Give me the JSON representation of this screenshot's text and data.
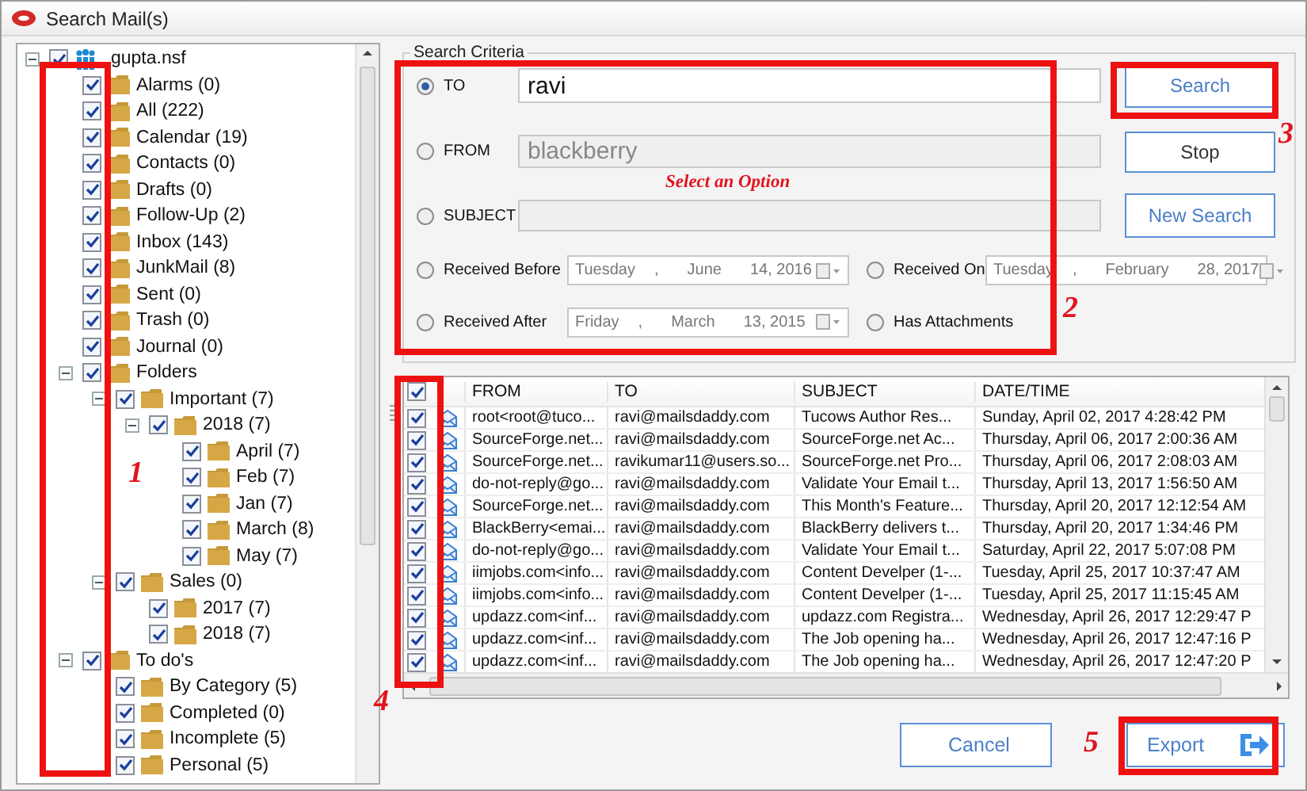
{
  "window": {
    "title": "Search Mail(s)"
  },
  "tree": {
    "label": "gupta.nsf",
    "checked": true,
    "expanded": true,
    "children": [
      {
        "label": "Alarms (0)",
        "checked": true
      },
      {
        "label": "All (222)",
        "checked": true
      },
      {
        "label": "Calendar (19)",
        "checked": true
      },
      {
        "label": "Contacts (0)",
        "checked": true
      },
      {
        "label": "Drafts (0)",
        "checked": true
      },
      {
        "label": "Follow-Up (2)",
        "checked": true
      },
      {
        "label": "Inbox (143)",
        "checked": true
      },
      {
        "label": "JunkMail (8)",
        "checked": true
      },
      {
        "label": "Sent (0)",
        "checked": true
      },
      {
        "label": "Trash (0)",
        "checked": true
      },
      {
        "label": "Journal (0)",
        "checked": true
      },
      {
        "label": "Folders",
        "checked": true,
        "expanded": true,
        "children": [
          {
            "label": "Important (7)",
            "checked": true,
            "expanded": true,
            "children": [
              {
                "label": "2018 (7)",
                "checked": true,
                "expanded": true,
                "children": [
                  {
                    "label": "April (7)",
                    "checked": true
                  },
                  {
                    "label": "Feb (7)",
                    "checked": true
                  },
                  {
                    "label": "Jan (7)",
                    "checked": true
                  },
                  {
                    "label": "March (8)",
                    "checked": true
                  },
                  {
                    "label": "May (7)",
                    "checked": true
                  }
                ]
              }
            ]
          },
          {
            "label": "Sales (0)",
            "checked": true,
            "expanded": true,
            "children": [
              {
                "label": "2017 (7)",
                "checked": true
              },
              {
                "label": "2018 (7)",
                "checked": true
              }
            ]
          }
        ]
      },
      {
        "label": "To do's",
        "checked": true,
        "expanded": true,
        "children": [
          {
            "label": "By Category (5)",
            "checked": true
          },
          {
            "label": "Completed (0)",
            "checked": true
          },
          {
            "label": "Incomplete (5)",
            "checked": true
          },
          {
            "label": "Personal (5)",
            "checked": true
          }
        ]
      }
    ]
  },
  "criteria": {
    "title": "Search Criteria",
    "fields": [
      {
        "label": "TO",
        "selected": true,
        "value": "ravi",
        "disabled": false
      },
      {
        "label": "FROM",
        "selected": false,
        "value": "blackberry",
        "disabled": true
      },
      {
        "label": "SUBJECT",
        "selected": false,
        "disabled": true
      }
    ],
    "hint": "Select an Option",
    "dates": [
      {
        "label": "Received Before",
        "selected": false,
        "parts": [
          "Tuesday",
          ",",
          "June",
          "14, 2016"
        ]
      },
      {
        "label": "Received On",
        "selected": false,
        "parts": [
          "Tuesday",
          ",",
          "February",
          "28, 2017"
        ]
      },
      {
        "label": "Received After",
        "selected": false,
        "parts": [
          "Friday",
          ",",
          "March",
          "13, 2015"
        ]
      }
    ],
    "attachments": {
      "label": "Has Attachments",
      "selected": false
    }
  },
  "actions": [
    {
      "label": "Search"
    },
    {
      "label": "Stop"
    },
    {
      "label": "New Search"
    }
  ],
  "table": {
    "all_checked": true,
    "columns": [
      "FROM",
      "TO",
      "SUBJECT",
      "DATE/TIME"
    ],
    "rows": [
      {
        "checked": true,
        "cells": [
          "root<root@tuco...",
          "ravi@mailsdaddy.com",
          "Tucows Author Res...",
          "Sunday, April 02, 2017 4:28:42 PM"
        ]
      },
      {
        "checked": true,
        "cells": [
          "SourceForge.net...",
          "ravi@mailsdaddy.com",
          "SourceForge.net Ac...",
          "Thursday, April 06, 2017 2:00:36 AM"
        ]
      },
      {
        "checked": true,
        "cells": [
          "SourceForge.net...",
          "ravikumar11@users.so...",
          "SourceForge.net Pro...",
          "Thursday, April 06, 2017 2:08:03 AM"
        ]
      },
      {
        "checked": true,
        "cells": [
          "do-not-reply@go...",
          "ravi@mailsdaddy.com",
          "Validate Your Email t...",
          "Thursday, April 13, 2017 1:56:50 AM"
        ]
      },
      {
        "checked": true,
        "cells": [
          "SourceForge.net...",
          "ravi@mailsdaddy.com",
          "This Month's Feature...",
          "Thursday, April 20, 2017 12:12:54 AM"
        ]
      },
      {
        "checked": true,
        "cells": [
          "BlackBerry<emai...",
          "ravi@mailsdaddy.com",
          "BlackBerry delivers t...",
          "Thursday, April 20, 2017 1:34:46 PM"
        ]
      },
      {
        "checked": true,
        "cells": [
          "do-not-reply@go...",
          "ravi@mailsdaddy.com",
          "Validate Your Email t...",
          "Saturday, April 22, 2017 5:07:08 PM"
        ]
      },
      {
        "checked": true,
        "cells": [
          "iimjobs.com<info...",
          "ravi@mailsdaddy.com",
          "Content Develper (1-...",
          "Tuesday, April 25, 2017 10:37:47 AM"
        ]
      },
      {
        "checked": true,
        "cells": [
          "iimjobs.com<info...",
          "ravi@mailsdaddy.com",
          "Content Develper (1-...",
          "Tuesday, April 25, 2017 11:15:45 AM"
        ]
      },
      {
        "checked": true,
        "cells": [
          "updazz.com<inf...",
          "ravi@mailsdaddy.com",
          "updazz.com Registra...",
          "Wednesday, April 26, 2017 12:29:47 P"
        ]
      },
      {
        "checked": true,
        "cells": [
          "updazz.com<inf...",
          "ravi@mailsdaddy.com",
          "The Job opening  ha...",
          "Wednesday, April 26, 2017 12:47:16 P"
        ]
      },
      {
        "checked": true,
        "cells": [
          "updazz.com<inf...",
          "ravi@mailsdaddy.com",
          "The Job opening  ha...",
          "Wednesday, April 26, 2017 12:47:20 P"
        ]
      }
    ]
  },
  "footer": [
    {
      "label": "Cancel",
      "kind": "plain"
    },
    {
      "label": "Export",
      "kind": "export"
    }
  ],
  "annotations": [
    {
      "number": "1"
    },
    {
      "number": "2"
    },
    {
      "number": "3"
    },
    {
      "number": "4"
    },
    {
      "number": "5"
    }
  ]
}
